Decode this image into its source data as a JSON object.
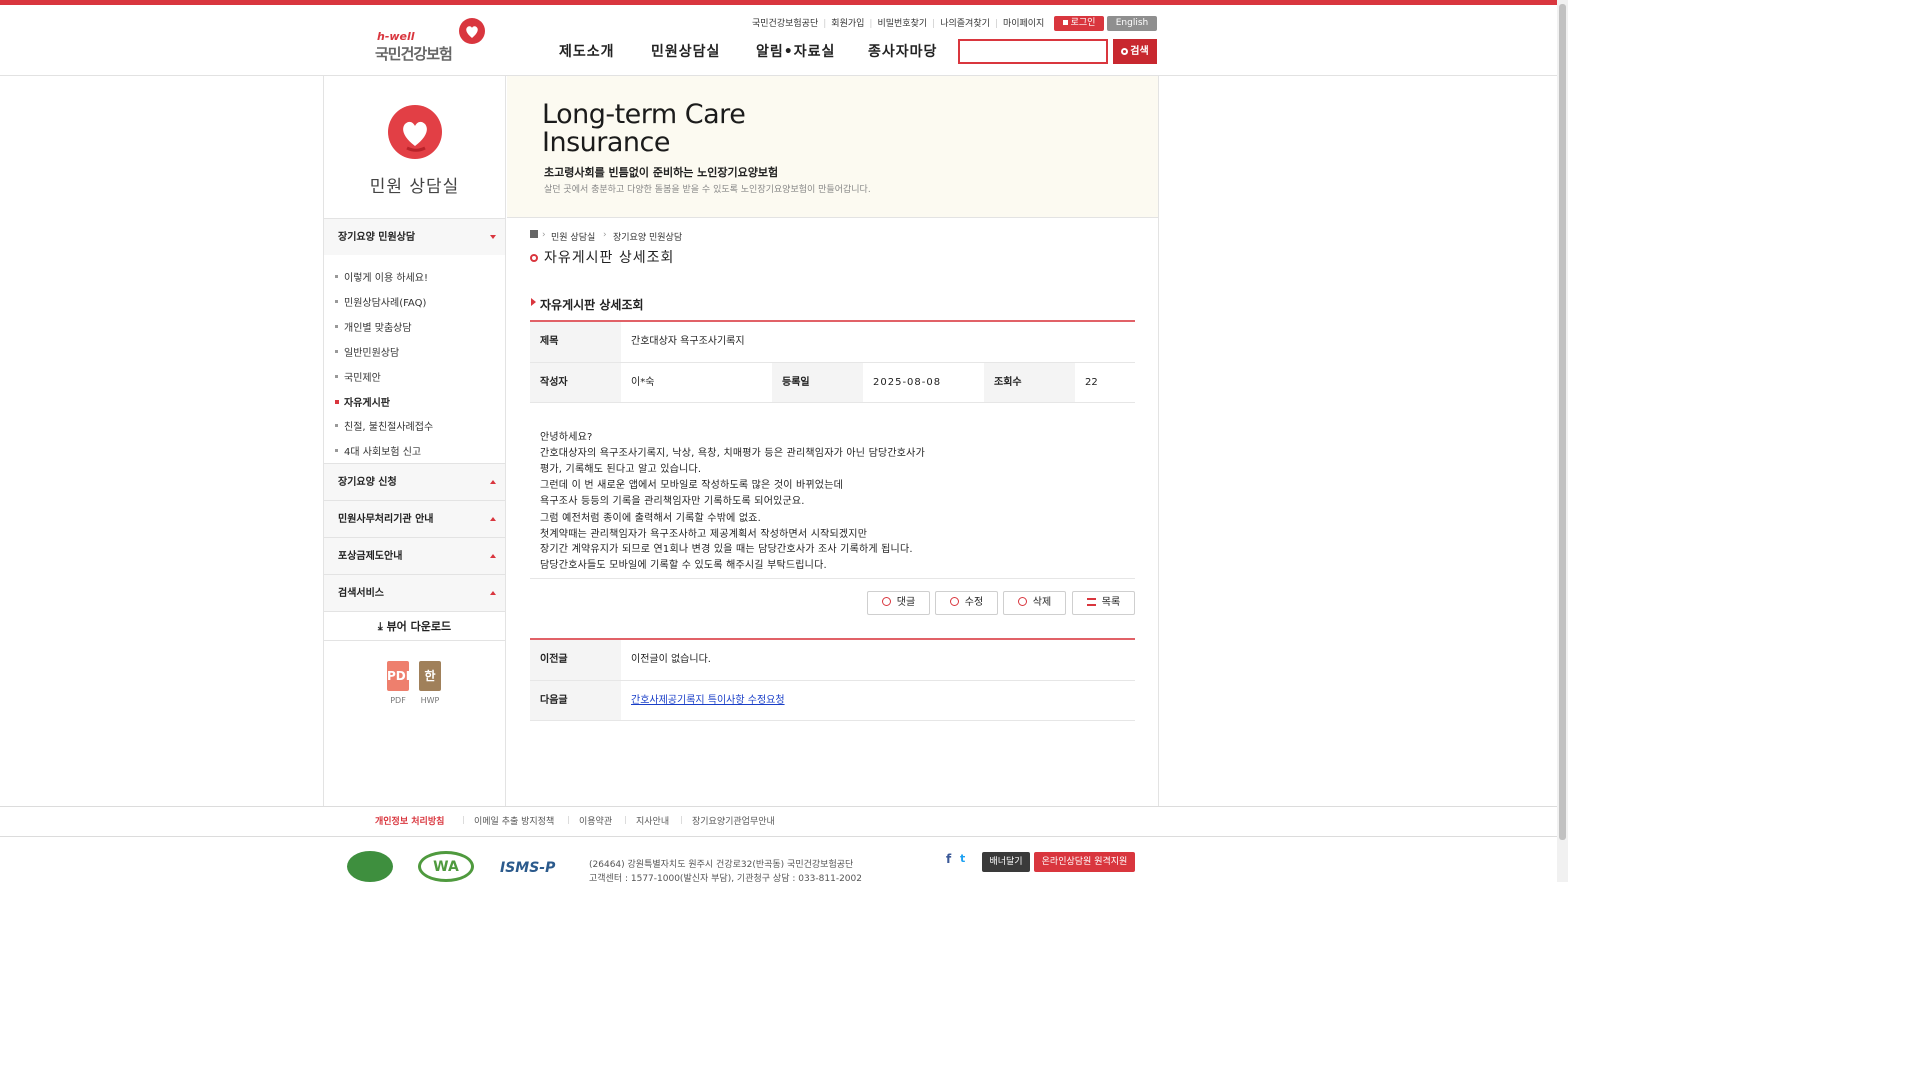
{
  "colors": {
    "brand_red": "#d9363e",
    "banner_bg": "#fcfaf1",
    "table_header_bg": "#f4f4f4"
  },
  "logo": {
    "hwell": "h-well",
    "name": "국민건강보험"
  },
  "util_nav": [
    "국민건강보험공단",
    "회원가입",
    "비밀번호찾기",
    "나의즐겨찾기",
    "마이페이지"
  ],
  "login_label": "로그인",
  "english_label": "English",
  "gnb": [
    "제도소개",
    "민원상담실",
    "알림•자료실",
    "종사자마당"
  ],
  "search": {
    "placeholder": "",
    "button": "검색"
  },
  "lnb": {
    "title": "민원 상담실",
    "group1": "장기요양 민원상담",
    "subs": [
      "이렇게 이용 하세요!",
      "민원상담사례(FAQ)",
      "개인별 맞춤상담",
      "일반민원상담",
      "국민제안",
      "자유게시판",
      "친절, 불친절사례접수",
      "4대 사회보험 신고"
    ],
    "groups": [
      "장기요양 신청",
      "민원사무처리기관 안내",
      "포상금제도안내",
      "검색서비스"
    ],
    "viewer": "⤓ 뷰어 다운로드",
    "files": [
      {
        "icon": "PDF",
        "label": "PDF"
      },
      {
        "icon": "한",
        "label": "HWP"
      }
    ]
  },
  "banner": {
    "title_line1": "Long-term Care",
    "title_line2": "Insurance",
    "subtitle": "초고령사회를 빈틈없이 준비하는 노인장기요양보험",
    "desc": "살던 곳에서 충분하고 다양한 돌봄을 받을 수 있도록 노인장기요양보험이 만들어갑니다."
  },
  "breadcrumb": [
    "민원 상담실",
    "장기요양 민원상담"
  ],
  "page_title": "자유게시판 상세조회",
  "section_title": "자유게시판 상세조회",
  "post": {
    "labels": {
      "title": "제목",
      "author": "작성자",
      "date": "등록일",
      "views": "조회수"
    },
    "title": "간호대상자 욕구조사기록지",
    "author": "이*숙",
    "date": "2025-08-08",
    "views": "22",
    "content": [
      "안녕하세요?",
      "간호대상자의 욕구조사기록지, 낙상, 욕창, 치매평가 등은 관리책임자가 아닌 담당간호사가",
      "평가, 기록해도 된다고 알고 있습니다.",
      "그런데 이 번 새로운 앱에서 모바일로 작성하도록 많은 것이 바뀌었는데",
      "욕구조사 등등의 기록을 관리책임자만 기록하도록 되어있군요.",
      "그럼 예전처럼 종이에 출력해서 기록할 수밖에 없죠.",
      "첫계약때는 관리책임자가 욕구조사하고 제공계획서 작성하면서 시작되겠지만",
      "장기간 계약유지가 되므로 연1회나 변경 있을 때는 담당간호사가 조사 기록하게 됩니다.",
      "담당간호사들도 모바일에 기록할 수 있도록 해주시길 부탁드립니다."
    ]
  },
  "buttons": {
    "reply": "댓글",
    "edit": "수정",
    "delete": "삭제",
    "list": "목록"
  },
  "nav_posts": {
    "prev_label": "이전글",
    "prev_value": "이전글이 없습니다.",
    "next_label": "다음글",
    "next_value": "간호사제공기록지 특이사항 수정요청"
  },
  "footer": {
    "links": [
      "개인정보 처리방침",
      "이메일 추출 방지정책",
      "이용약관",
      "지사안내",
      "장기요양기관업무안내"
    ],
    "address": "(26464) 강원특별자치도 원주시 건강로32(반곡동) 국민건강보험공단",
    "phone": "고객센터 : 1577-1000(발신자 부담), 기관청구 상담 : 033-811-2002",
    "certs": [
      "",
      "WA",
      "ISMS-P"
    ],
    "banner_btn": "배너달기",
    "online_btn": "온라인상담원 원격지원"
  }
}
